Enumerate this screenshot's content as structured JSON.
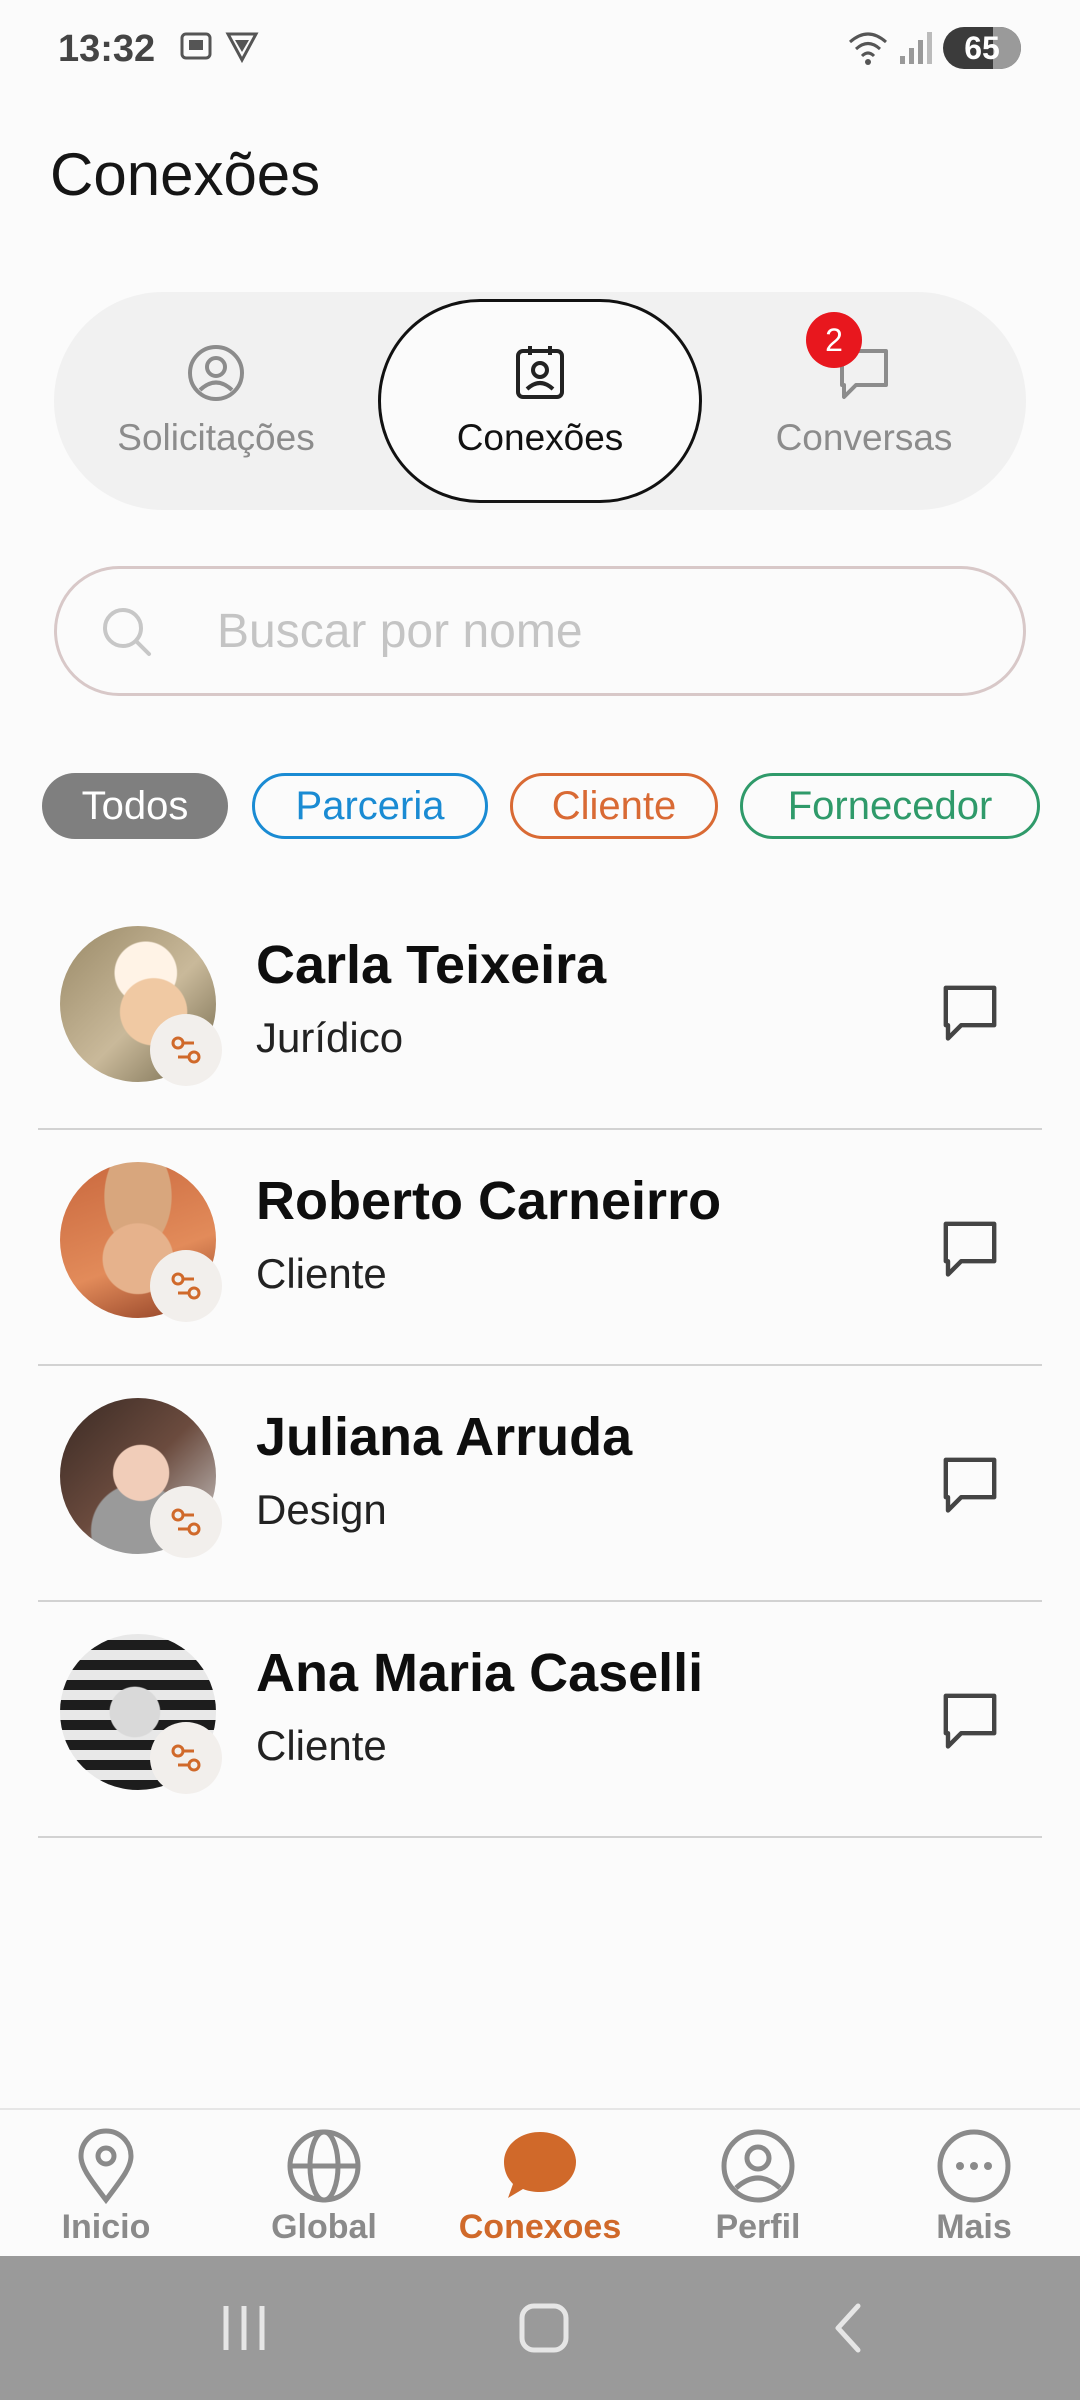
{
  "status_bar": {
    "time": "13:32",
    "battery": "65"
  },
  "page": {
    "title": "Conexões"
  },
  "segments": [
    {
      "label": "Solicitações",
      "icon": "user-circle-icon"
    },
    {
      "label": "Conexões",
      "icon": "contact-badge-icon",
      "active": true
    },
    {
      "label": "Conversas",
      "icon": "chat-bubble-icon",
      "badge": "2"
    }
  ],
  "search": {
    "placeholder": "Buscar por nome",
    "value": ""
  },
  "filters": [
    {
      "label": "Todos",
      "selected": true,
      "color": "#7f7f7f"
    },
    {
      "label": "Parceria",
      "color": "#1a8bd3"
    },
    {
      "label": "Cliente",
      "color": "#d96a34"
    },
    {
      "label": "Fornecedor",
      "color": "#2f9a6a"
    }
  ],
  "connections": [
    {
      "name": "Carla Teixeira",
      "role": "Jurídico"
    },
    {
      "name": "Roberto Carneirro",
      "role": "Cliente"
    },
    {
      "name": "Juliana Arruda",
      "role": "Design"
    },
    {
      "name": "Ana Maria Caselli",
      "role": "Cliente"
    }
  ],
  "bottom_nav": [
    {
      "label": "Inicio",
      "icon": "location-pin-icon"
    },
    {
      "label": "Global",
      "icon": "globe-icon"
    },
    {
      "label": "Conexoes",
      "icon": "chat-bubble-filled-icon",
      "active": true
    },
    {
      "label": "Perfil",
      "icon": "profile-icon"
    },
    {
      "label": "Mais",
      "icon": "more-dots-icon"
    }
  ],
  "colors": {
    "accent": "#d0692a",
    "badge": "#e8171e",
    "background": "#fbfbfb"
  }
}
